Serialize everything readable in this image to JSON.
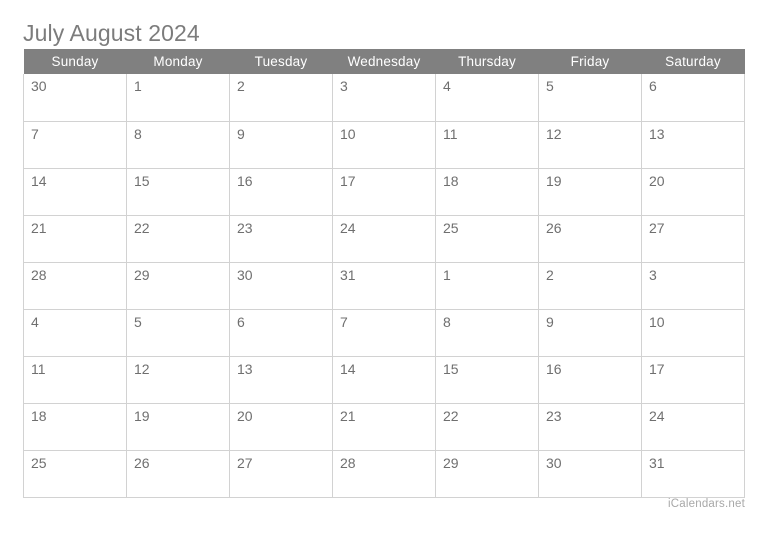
{
  "calendar": {
    "title": "July August 2024",
    "weekday_headers": [
      "Sunday",
      "Monday",
      "Tuesday",
      "Wednesday",
      "Thursday",
      "Friday",
      "Saturday"
    ],
    "weeks": [
      {
        "days": [
          {
            "num": "30",
            "dim": true
          },
          {
            "num": "1",
            "dim": false
          },
          {
            "num": "2",
            "dim": false
          },
          {
            "num": "3",
            "dim": false
          },
          {
            "num": "4",
            "dim": false
          },
          {
            "num": "5",
            "dim": false
          },
          {
            "num": "6",
            "dim": false
          }
        ]
      },
      {
        "days": [
          {
            "num": "7",
            "dim": false
          },
          {
            "num": "8",
            "dim": false
          },
          {
            "num": "9",
            "dim": false
          },
          {
            "num": "10",
            "dim": false
          },
          {
            "num": "11",
            "dim": false
          },
          {
            "num": "12",
            "dim": false
          },
          {
            "num": "13",
            "dim": false
          }
        ]
      },
      {
        "days": [
          {
            "num": "14",
            "dim": false
          },
          {
            "num": "15",
            "dim": false
          },
          {
            "num": "16",
            "dim": false
          },
          {
            "num": "17",
            "dim": false
          },
          {
            "num": "18",
            "dim": false
          },
          {
            "num": "19",
            "dim": false
          },
          {
            "num": "20",
            "dim": false
          }
        ]
      },
      {
        "days": [
          {
            "num": "21",
            "dim": false
          },
          {
            "num": "22",
            "dim": false
          },
          {
            "num": "23",
            "dim": false
          },
          {
            "num": "24",
            "dim": false
          },
          {
            "num": "25",
            "dim": false
          },
          {
            "num": "26",
            "dim": false
          },
          {
            "num": "27",
            "dim": false
          }
        ]
      },
      {
        "days": [
          {
            "num": "28",
            "dim": false,
            "edges": [
              "left",
              "bottom"
            ]
          },
          {
            "num": "29",
            "dim": false,
            "edges": [
              "bottom"
            ]
          },
          {
            "num": "30",
            "dim": false,
            "edges": [
              "bottom"
            ]
          },
          {
            "num": "31",
            "dim": false,
            "edges": [
              "bottom",
              "right"
            ]
          },
          {
            "num": "1",
            "dim": false,
            "edges": [
              "top",
              "left"
            ]
          },
          {
            "num": "2",
            "dim": false,
            "edges": [
              "top"
            ]
          },
          {
            "num": "3",
            "dim": false,
            "edges": [
              "top"
            ]
          }
        ]
      },
      {
        "days": [
          {
            "num": "4",
            "dim": false
          },
          {
            "num": "5",
            "dim": false
          },
          {
            "num": "6",
            "dim": false
          },
          {
            "num": "7",
            "dim": false
          },
          {
            "num": "8",
            "dim": false
          },
          {
            "num": "9",
            "dim": false
          },
          {
            "num": "10",
            "dim": false
          }
        ]
      },
      {
        "days": [
          {
            "num": "11",
            "dim": false
          },
          {
            "num": "12",
            "dim": false
          },
          {
            "num": "13",
            "dim": false
          },
          {
            "num": "14",
            "dim": false
          },
          {
            "num": "15",
            "dim": false
          },
          {
            "num": "16",
            "dim": false
          },
          {
            "num": "17",
            "dim": false
          }
        ]
      },
      {
        "days": [
          {
            "num": "18",
            "dim": false
          },
          {
            "num": "19",
            "dim": false
          },
          {
            "num": "20",
            "dim": false
          },
          {
            "num": "21",
            "dim": false
          },
          {
            "num": "22",
            "dim": false
          },
          {
            "num": "23",
            "dim": false
          },
          {
            "num": "24",
            "dim": false
          }
        ]
      },
      {
        "days": [
          {
            "num": "25",
            "dim": false
          },
          {
            "num": "26",
            "dim": false
          },
          {
            "num": "27",
            "dim": false
          },
          {
            "num": "28",
            "dim": false
          },
          {
            "num": "29",
            "dim": false
          },
          {
            "num": "30",
            "dim": false
          },
          {
            "num": "31",
            "dim": false
          }
        ]
      }
    ]
  },
  "footer": {
    "credit": "iCalendars.net"
  },
  "colors": {
    "header_background": "#808080",
    "header_text": "#ffffff",
    "title_text": "#7c7c7c",
    "day_text": "#6f6f6f",
    "dim_background": "#ececec",
    "dim_text": "#b4b4b4",
    "grid_border": "#d2d2d2",
    "month_outline": "#6e6e6e",
    "credit_text": "#a8a8a8",
    "page_background": "#ffffff"
  }
}
